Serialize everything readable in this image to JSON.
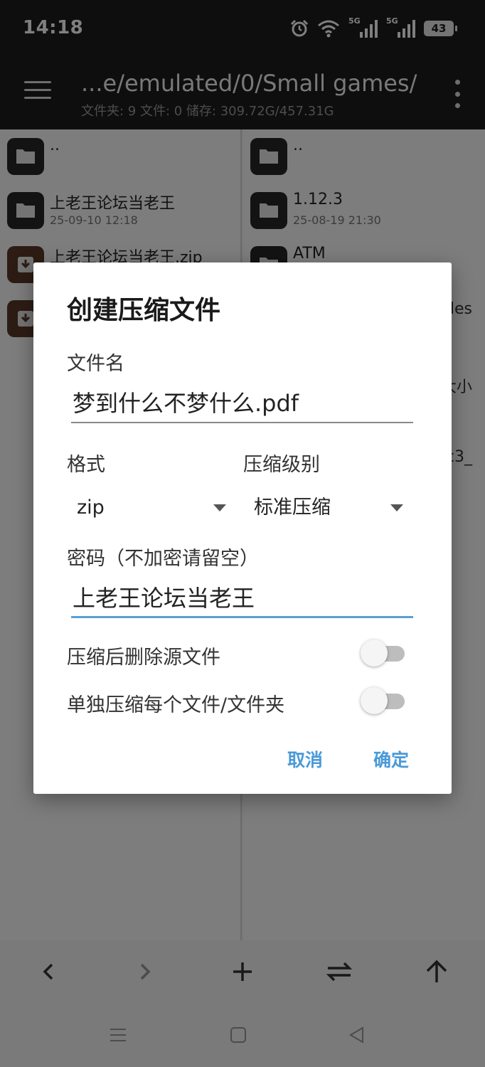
{
  "status_bar": {
    "time": "14:18",
    "battery": "43",
    "network": "5G",
    "icons": [
      "alarm-icon",
      "wifi-icon",
      "signal-5g-icon",
      "signal-5g-icon",
      "battery-icon"
    ]
  },
  "toolbar": {
    "path": "...e/emulated/0/Small games/",
    "stats": "文件夹: 9  文件: 0  储存: 309.72G/457.31G"
  },
  "left_pane": {
    "items": [
      {
        "name": "..",
        "date": "",
        "icon": "folder-icon"
      },
      {
        "name": "上老王论坛当老王",
        "date": "25-09-10 12:18",
        "icon": "folder-icon"
      },
      {
        "name": "上老王论坛当老王.zip",
        "date": "",
        "icon": "archive-icon"
      },
      {
        "name": "",
        "date": "",
        "icon": "archive-icon"
      }
    ]
  },
  "right_pane": {
    "items": [
      {
        "name": "..",
        "date": "",
        "icon": "folder-icon"
      },
      {
        "name": "1.12.3",
        "date": "25-08-19 21:30",
        "icon": "folder-icon"
      },
      {
        "name": "ATM",
        "date": "",
        "icon": "folder-icon"
      }
    ],
    "peek": [
      "les",
      "大小",
      "c3_"
    ]
  },
  "dialog": {
    "title": "创建压缩文件",
    "filename_label": "文件名",
    "filename_value": "梦到什么不梦什么.pdf",
    "format_label": "格式",
    "format_value": "zip",
    "level_label": "压缩级别",
    "level_value": "标准压缩",
    "password_label": "密码（不加密请留空）",
    "password_value": "上老王论坛当老王",
    "delete_source_label": "压缩后删除源文件",
    "delete_source_on": false,
    "separate_label": "单独压缩每个文件/文件夹",
    "separate_on": false,
    "cancel_label": "取消",
    "ok_label": "确定"
  },
  "colors": {
    "accent": "#4a9ad8",
    "toolbar_bg": "#1c1c1c",
    "folder_icon": "#262626",
    "archive_icon": "#5a3828"
  }
}
